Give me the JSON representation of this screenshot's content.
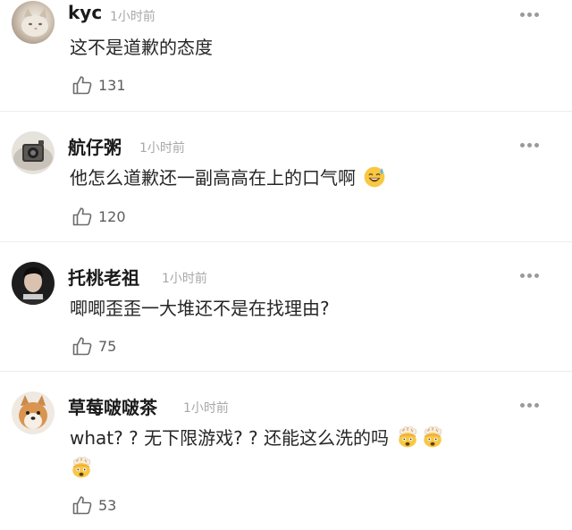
{
  "comments": [
    {
      "username": "kyc",
      "time": "1小时前",
      "text": "这不是道歉的态度",
      "likes": "131",
      "emojis": []
    },
    {
      "username": "航仔粥",
      "time": "1小时前",
      "text": "他怎么道歉还一副高高在上的口气啊",
      "likes": "120",
      "emojis": [
        "sweat-smile-emoji"
      ]
    },
    {
      "username": "托桃老祖",
      "time": "1小时前",
      "text": "唧唧歪歪一大堆还不是在找理由?",
      "likes": "75",
      "emojis": []
    },
    {
      "username": "草莓啵啵茶",
      "time": "1小时前",
      "text": "what? ? 无下限游戏? ? 还能这么洗的吗",
      "likes": "53",
      "emojis": [
        "exploding-head-emoji",
        "exploding-head-emoji",
        "exploding-head-emoji"
      ]
    }
  ],
  "colors": {
    "text": "#262626",
    "meta": "#a8a8a8",
    "icon": "#6b6b6b",
    "divider": "#ececec"
  },
  "icons": {
    "like": "thumbs-up-icon",
    "more": "more-dots-icon"
  }
}
